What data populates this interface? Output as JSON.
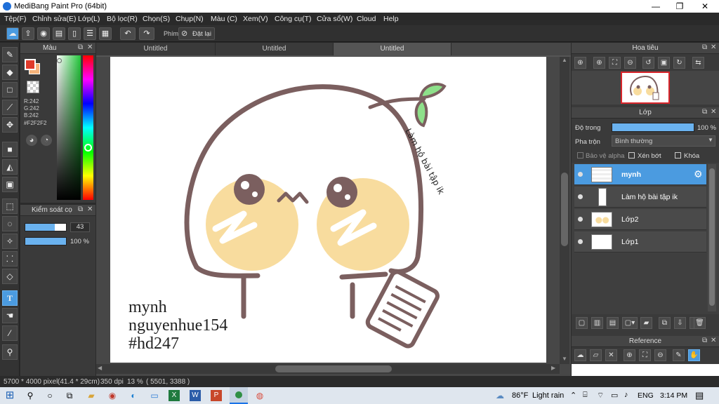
{
  "window": {
    "title": "MediBang Paint Pro (64bit)",
    "minimize": "—",
    "maximize": "❐",
    "close": "✕"
  },
  "menu": [
    "Tệp(F)",
    "Chỉnh sửa(E)",
    "Lớp(L)",
    "Bộ lọc(R)",
    "Chọn(S)",
    "Chụp(N)",
    "Màu (C)",
    "Xem(V)",
    "Công cụ(T)",
    "Cửa sổ(W)",
    "Cloud",
    "Help"
  ],
  "toolbar": {
    "shortcut_label": "Phím",
    "reset_label": "Đặt lại"
  },
  "color_panel": {
    "title": "Màu",
    "rgb": [
      "R:242",
      "G:242",
      "B:242"
    ],
    "hex": "#F2F2F2",
    "fg_color": "#e03a2a",
    "bg_color": "#f5b37a"
  },
  "brush_panel": {
    "title": "Kiểm soát cọ",
    "size": "43",
    "opacity": "100 %",
    "size_fraction": 0.72,
    "opacity_fraction": 1.0
  },
  "doc_tabs": [
    "Untitled",
    "Untitled",
    "Untitled"
  ],
  "canvas_text": {
    "sign_lines": [
      "mynh",
      "nguyenhue154",
      "#hd247"
    ],
    "curved_text": "Làm hộ bài tập ik"
  },
  "navigator": {
    "title": "Hoa tiêu"
  },
  "layers": {
    "title": "Lớp",
    "opacity_label": "Độ trong",
    "opacity_value": "100 %",
    "opacity_fraction": 1.0,
    "blend_label": "Pha trộn",
    "blend_value": "Bình thường",
    "protect_alpha": "Bảo vệ alpha",
    "clipping": "Xén bớt",
    "lock": "Khóa",
    "items": [
      {
        "name": "mynh",
        "selected": true
      },
      {
        "name": "Làm hộ bài tập ik",
        "selected": false
      },
      {
        "name": "Lớp2",
        "selected": false
      },
      {
        "name": "Lớp1",
        "selected": false
      }
    ]
  },
  "reference": {
    "title": "Reference"
  },
  "status": {
    "size": "5700 * 4000 pixel",
    "cm": "(41.4 * 29cm)",
    "dpi": "350 dpi",
    "zoom": "13 %",
    "coords": "( 5501, 3388 )"
  },
  "taskbar": {
    "weather_temp": "86°F",
    "weather_text": "Light rain",
    "lang": "ENG",
    "time": "3:14 PM"
  }
}
